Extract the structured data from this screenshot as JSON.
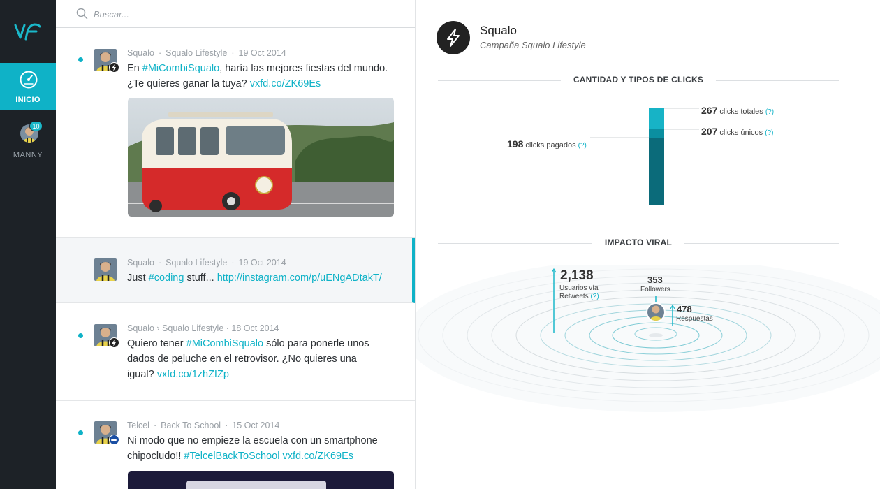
{
  "sidebar": {
    "logo_text": "VF",
    "home_label": "INICIO",
    "user_label": "MANNY",
    "user_badge": "10"
  },
  "search": {
    "placeholder": "Buscar..."
  },
  "posts": [
    {
      "account": "Squalo",
      "campaign": "Squalo Lifestyle",
      "date": "19 Oct 2014",
      "text_parts": [
        "En ",
        "#MiCombiSqualo",
        ", haría las mejores fiestas del mundo.",
        "¿Te quieres ganar la tuya? ",
        "vxfd.co/ZK69Es"
      ],
      "unread": true
    },
    {
      "account": "Squalo",
      "campaign": "Squalo Lifestyle",
      "date": "19 Oct 2014",
      "text_parts": [
        "Just ",
        "#coding",
        " stuff... ",
        "http://instagram.com/p/uENgADtakT/"
      ],
      "unread": false
    },
    {
      "meta": "Squalo › Squalo Lifestyle · 18 Oct 2014",
      "text_parts": [
        "Quiero tener ",
        "#MiCombiSqualo",
        " sólo para ponerle unos",
        "dados de peluche en el retrovisor. ¿No quieres una",
        "igual? ",
        "vxfd.co/1zhZIZp"
      ],
      "unread": true
    },
    {
      "account": "Telcel",
      "campaign": "Back To School",
      "date": "15 Oct 2014",
      "text_parts": [
        "Ni modo que no empieze la escuela con un smartphone",
        "chipocludo!! ",
        "#TelcelBackToSchool vxfd.co/ZK69Es"
      ],
      "unread": true
    }
  ],
  "meta_sep": "·",
  "campaign": {
    "name": "Squalo",
    "subtitle": "Campaña Squalo Lifestyle"
  },
  "clicks": {
    "title": "CANTIDAD Y TIPOS DE CLICKS",
    "total": 267,
    "total_label": "clicks totales",
    "unique": 207,
    "unique_label": "clicks únicos",
    "paid": 198,
    "paid_label": "clicks pagados",
    "help": "(?)"
  },
  "viral": {
    "title": "IMPACTO VIRAL",
    "retweet_users": "2,138",
    "retweet_label_1": "Usuarios vía",
    "retweet_label_2": "Retweets",
    "followers": "353",
    "followers_label": "Followers",
    "replies": "478",
    "replies_label": "Respuestas",
    "help": "(?)"
  },
  "colors": {
    "accent": "#0fb2c7",
    "sidebar": "#1d2227",
    "bar_dark": "#0b6b7a"
  }
}
